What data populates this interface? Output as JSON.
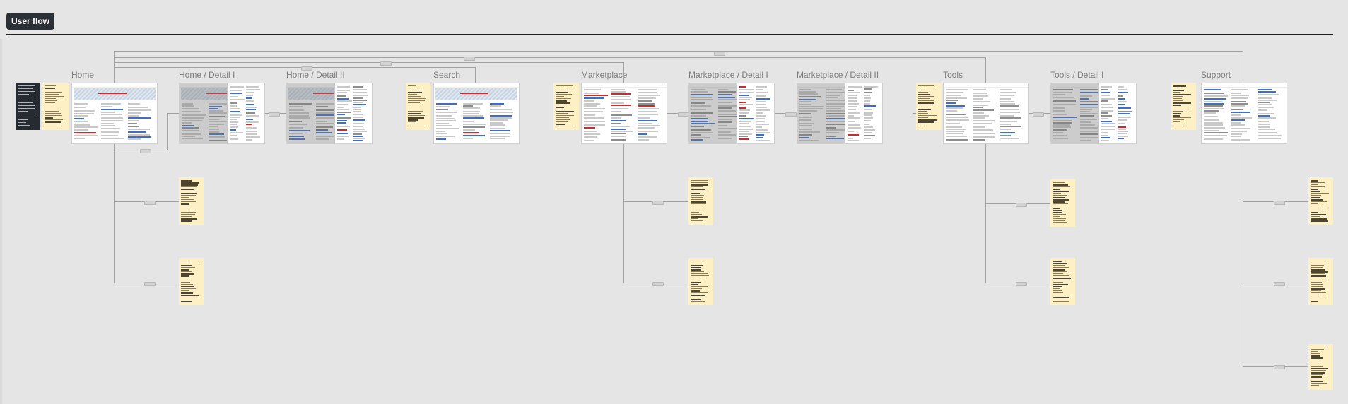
{
  "title": "User flow",
  "frames": [
    {
      "id": "home",
      "label": "Home"
    },
    {
      "id": "home-detail-1",
      "label": "Home / Detail I"
    },
    {
      "id": "home-detail-2",
      "label": "Home / Detail II"
    },
    {
      "id": "search",
      "label": "Search"
    },
    {
      "id": "marketplace",
      "label": "Marketplace"
    },
    {
      "id": "marketplace-detail-1",
      "label": "Marketplace / Detail I"
    },
    {
      "id": "marketplace-detail-2",
      "label": "Marketplace / Detail II"
    },
    {
      "id": "tools",
      "label": "Tools"
    },
    {
      "id": "tools-detail-1",
      "label": "Tools / Detail I"
    },
    {
      "id": "support",
      "label": "Support"
    }
  ],
  "colors": {
    "background": "#e5e5e5",
    "title_badge": "#2b2f36",
    "sticky_note": "#fdf0c5",
    "connector": "#a0a0a0",
    "accent_blue": "#3d6ec9",
    "accent_red": "#cc2b2b"
  }
}
